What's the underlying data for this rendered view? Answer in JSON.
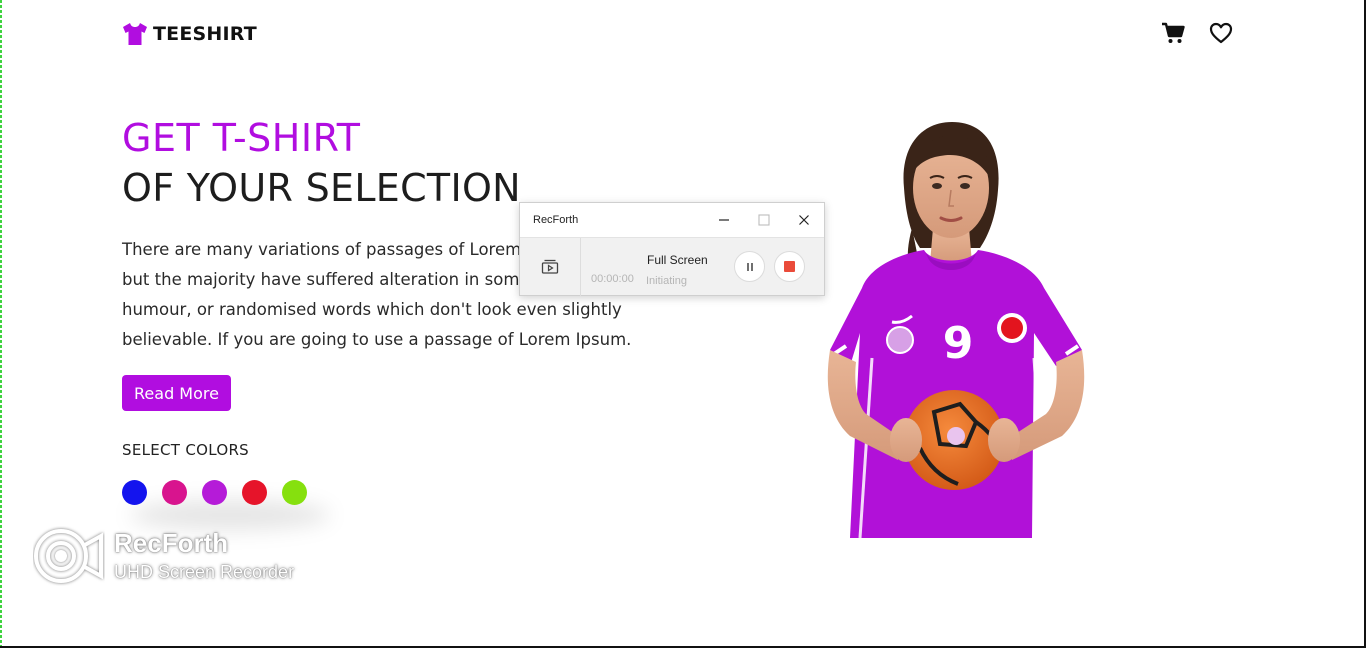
{
  "header": {
    "brand": "TEESHIRT",
    "brand_icon": "tshirt-icon",
    "icons": [
      "cart-icon",
      "heart-icon"
    ]
  },
  "hero": {
    "headline_line1": "GET T-SHIRT",
    "headline_line2": "OF YOUR SELECTION",
    "description_lines": [
      "There are many variations of passages of Lorem Ip",
      "but the majority have suffered alteration in some f",
      "humour, or randomised words which don't look even slightly",
      "believable. If you are going to use a passage of Lorem Ipsum."
    ],
    "read_more_label": "Read More",
    "colors_label": "SELECT COLORS",
    "swatches": [
      "#1414ee",
      "#d8148e",
      "#b51bd8",
      "#e6142a",
      "#86e00e"
    ],
    "accent": "#b10de0"
  },
  "recorder": {
    "title": "RecForth",
    "mode_label": "Full Screen",
    "time": "00:00:00",
    "status": "Initiating"
  },
  "watermark": {
    "title": "RecForth",
    "subtitle": "UHD Screen Recorder"
  }
}
